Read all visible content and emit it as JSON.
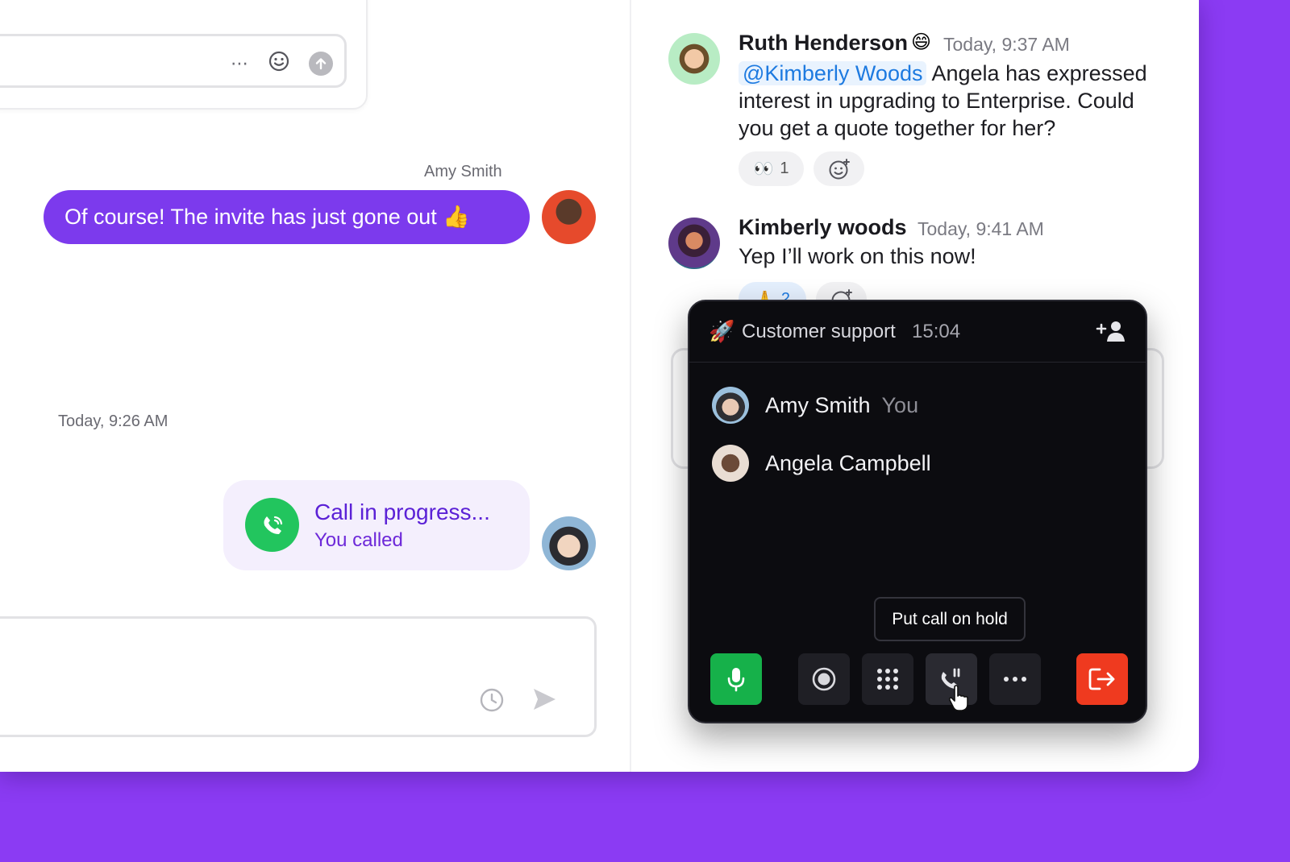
{
  "colors": {
    "background": "#8b3bf3",
    "bubble_purple": "#7c3aed",
    "call_green": "#22c55e",
    "mention_blue": "#1d7ae0",
    "leave_red": "#ef3a1f",
    "mic_green": "#16b14a"
  },
  "left_chat": {
    "sender_name": "Amy Smith",
    "message": "Of course! The invite has just gone out 👍",
    "timestamp": "Today, 9:26 AM",
    "call_card": {
      "title": "Call in progress...",
      "subtitle": "You called"
    }
  },
  "thread": {
    "messages": [
      {
        "author": "Ruth Henderson",
        "emoji": "😄",
        "time": "Today, 9:37 AM",
        "mention": "@Kimberly Woods",
        "text": " Angela has expressed interest in upgrading to Enterprise. Could you get a quote together for her?",
        "reactions": [
          {
            "emoji": "👀",
            "count": "1"
          }
        ]
      },
      {
        "author": "Kimberly woods",
        "time": "Today, 9:41 AM",
        "text": "Yep I’ll work on this now!",
        "reactions": [
          {
            "emoji": "🙏",
            "count": "2"
          }
        ]
      }
    ]
  },
  "call_panel": {
    "icon": "rocket-icon",
    "emoji": "🚀",
    "title": "Customer support",
    "timer": "15:04",
    "participants": [
      {
        "name": "Amy Smith",
        "tag": "You"
      },
      {
        "name": "Angela Campbell",
        "tag": ""
      }
    ],
    "tooltip": "Put call on hold",
    "controls": [
      "microphone",
      "record",
      "keypad",
      "hold",
      "more",
      "leave"
    ]
  }
}
